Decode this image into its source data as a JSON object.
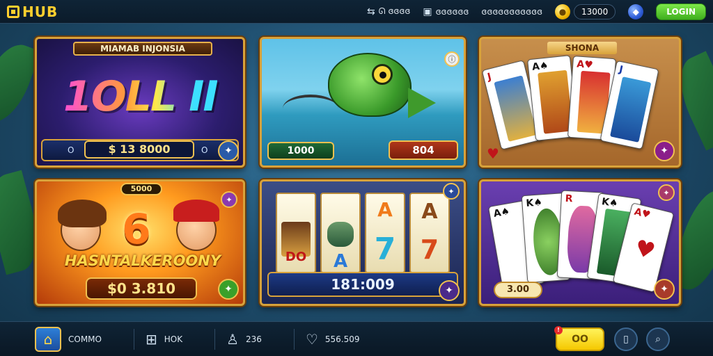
{
  "header": {
    "logo_text": "HUB",
    "stats": [
      {
        "icon": "swap-icon",
        "value": "ᘏ ɞɞɞɞ"
      },
      {
        "icon": "wallet-icon",
        "value": "ɞɞɞɞɞɞ"
      },
      {
        "icon": "user-icon",
        "value": "ɞɞɞɞɞɞɞɞɞɞɞ"
      }
    ],
    "balance": "13000",
    "login_label": "LOGIN"
  },
  "tiles": {
    "tile1": {
      "banner": "MIAMAB INJONSIA",
      "title": "1OLL II",
      "jackpot": "$ 13 8000",
      "left_mark": "O",
      "right_mark": "O"
    },
    "tile2": {
      "left_value": "1000",
      "right_value": "804"
    },
    "tile3": {
      "banner": "SHONA"
    },
    "tile4": {
      "top_value": "5000",
      "number": "6",
      "title": "HASNTALKEROONY",
      "amount": "$0 3.810"
    },
    "tile5": {
      "reel_symbols": [
        "DO",
        "A",
        "7",
        "A 7"
      ],
      "value": "181:009"
    },
    "tile6": {
      "chip": "3.00"
    }
  },
  "nav": {
    "items": [
      {
        "icon": "home-icon",
        "label": "COMMO"
      },
      {
        "icon": "store-icon",
        "label": "HOK"
      },
      {
        "icon": "profile-icon",
        "label": "236"
      },
      {
        "icon": "heart-icon",
        "label": "556.509"
      }
    ],
    "yellow_button": "OO"
  },
  "colors": {
    "accent": "#ffcf2e",
    "login_green": "#3fae1e",
    "frame_gold": "#d8a23a"
  }
}
